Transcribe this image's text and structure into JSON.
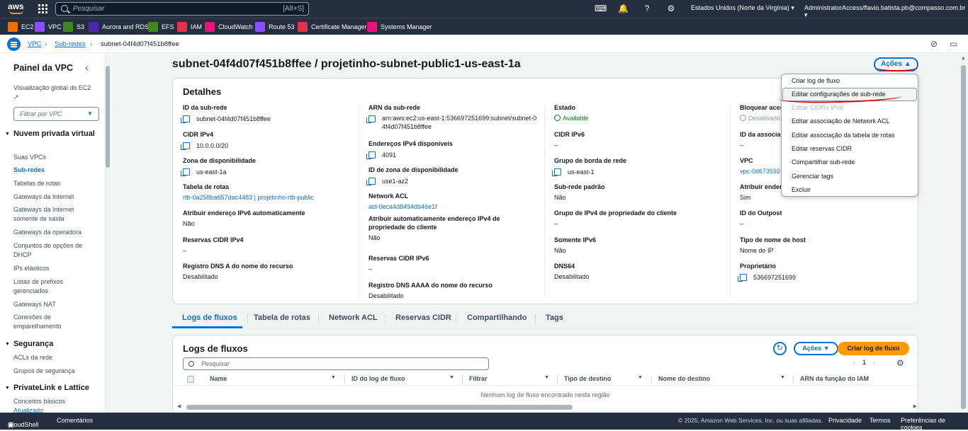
{
  "topnav": {
    "logo": "aws",
    "search_placeholder": "Pesquisar",
    "search_shortcut": "[Alt+S]",
    "icons": [
      "cloudshell-icon",
      "bell-icon",
      "help-icon",
      "gear-icon"
    ],
    "region": "Estados Unidos (Norte da Virgínia) ▾",
    "account": "AdministratorAccess/flavio.batista.pb@compasso.com.br ▾"
  },
  "favorites": [
    {
      "label": "EC2",
      "color": "#ed7100"
    },
    {
      "label": "VPC",
      "color": "#8c4fff"
    },
    {
      "label": "S3",
      "color": "#3f8624"
    },
    {
      "label": "Aurora and RDS",
      "color": "#4d27aa"
    },
    {
      "label": "EFS",
      "color": "#3f8624"
    },
    {
      "label": "IAM",
      "color": "#dd344c"
    },
    {
      "label": "CloudWatch",
      "color": "#e7157b"
    },
    {
      "label": "Route 53",
      "color": "#8c4fff"
    },
    {
      "label": "Certificate Manager",
      "color": "#dd344c"
    },
    {
      "label": "Systems Manager",
      "color": "#e7157b"
    }
  ],
  "breadcrumb": [
    "VPC",
    "Sub-redes",
    "subnet-04f4d07f451b8ffee"
  ],
  "sidebar": {
    "title": "Painel da VPC",
    "global_view": "Visualização global do EC2",
    "filter_placeholder": "Filtrar por VPC",
    "sections": {
      "cloud": "Nuvem privada virtual",
      "security": "Segurança",
      "privatelink": "PrivateLink e Lattice"
    },
    "items": {
      "vpcs": "Suas VPCs",
      "subnets": "Sub-redes",
      "route_tables": "Tabelas de rotas",
      "igw": "Gateways da Internet",
      "egress_igw": "Gateways da Internet somente de saída",
      "carrier_gw": "Gateways da operadora",
      "dhcp": "Conjuntos de opções de DHCP",
      "eips": "IPs elásticos",
      "prefix_lists": "Listas de prefixos gerenciados",
      "nat": "Gateways NAT",
      "peering": "Conexões de emparelhamento",
      "acls": "ACLs da rede",
      "security_groups": "Grupos de segurança",
      "concepts": "Conceitos básicos",
      "updated": "Atualizado"
    }
  },
  "page": {
    "title": "subnet-04f4d07f451b8ffee / projetinho-subnet-public1-us-east-1a",
    "actions_label": "Ações ▲"
  },
  "details": {
    "title": "Detalhes",
    "col1": [
      {
        "label": "ID da sub-rede",
        "value": "subnet-04f4d07f451b8ffee"
      },
      {
        "label": "CIDR IPv4",
        "value": "10.0.0.0/20"
      },
      {
        "label": "Zona de disponibilidade",
        "value": "us-east-1a"
      },
      {
        "label": "Tabela de rotas",
        "value": "rtb-0a258ba657dac4483 | projetinho-rtb-public"
      },
      {
        "label": "Atribuir endereço IPv6 automaticamente",
        "value": "Não"
      },
      {
        "label": "Reservas CIDR IPv4",
        "value": "–"
      },
      {
        "label": "Registro DNS A do nome do recurso",
        "value": "Desabilitado"
      }
    ],
    "col2": [
      {
        "label": "ARN da sub-rede",
        "value": "arn:aws:ec2:us-east-1:536697251699:subnet/subnet-04f4d07f451b8ffee"
      },
      {
        "label": "Endereços IPv4 disponíveis",
        "value": "4091"
      },
      {
        "label": "ID de zona de disponibilidade",
        "value": "use1-az2"
      },
      {
        "label": "Network ACL",
        "value": "acl-0eca4d8494db46e1f"
      },
      {
        "label": "Atribuir automaticamente endereço IPv4 de propriedade do cliente",
        "value": "Não"
      },
      {
        "label": "Reservas CIDR IPv6",
        "value": "–"
      },
      {
        "label": "Registro DNS AAAA do nome do recurso",
        "value": "Desabilitado"
      }
    ],
    "col3": [
      {
        "label": "Estado",
        "value": "Available"
      },
      {
        "label": "CIDR IPv6",
        "value": "–"
      },
      {
        "label": "Grupo de borda de rede",
        "value": "us-east-1"
      },
      {
        "label": "Sub-rede padrão",
        "value": "Não"
      },
      {
        "label": "Grupo de IPv4 de propriedade do cliente",
        "value": "–"
      },
      {
        "label": "Somente IPv6",
        "value": "Não"
      },
      {
        "label": "DNS64",
        "value": "Desabilitado"
      }
    ],
    "col4": [
      {
        "label": "Bloquear aces",
        "value": "Desativado"
      },
      {
        "label": "ID da associa",
        "value": "–"
      },
      {
        "label": "VPC",
        "value": "vpc-0d673592"
      },
      {
        "label": "Atribuir ender",
        "value": "Sim"
      },
      {
        "label": "ID do Outpost",
        "value": "–"
      },
      {
        "label": "Tipo de nome de host",
        "value": "Nome do IP"
      },
      {
        "label": "Proprietário",
        "value": "536697251699"
      }
    ]
  },
  "actions_menu": [
    "Criar log de fluxo",
    "Editar configurações de sub-rede",
    "Editar CIDRs IPv6",
    "Editar associação de Network ACL",
    "Editar associação da tabela de rotas",
    "Editar reservas CIDR",
    "Compartilhar sub-rede",
    "Gerenciar tags",
    "Excluir"
  ],
  "tabs": [
    "Logs de fluxos",
    "Tabela de rotas",
    "Network ACL",
    "Reservas CIDR",
    "Compartilhando",
    "Tags"
  ],
  "flow_logs": {
    "title": "Logs de fluxos",
    "actions_label": "Ações ▼",
    "create_label": "Criar log de fluxo",
    "search_placeholder": "Pesquisar",
    "page": "1",
    "columns": [
      "Name",
      "ID do log de fluxo",
      "Filtrar",
      "Tipo de destino",
      "Nome do destino",
      "ARN da função do IAM"
    ],
    "empty": "Nenhum log de fluxo encontrado nesta região"
  },
  "footer": {
    "cloudshell": "CloudShell",
    "feedback": "Comentários",
    "copyright": "© 2025, Amazon Web Services, Inc. ou suas afiliadas.",
    "privacy": "Privacidade",
    "terms": "Termos",
    "cookies": "Preferências de cookies"
  }
}
